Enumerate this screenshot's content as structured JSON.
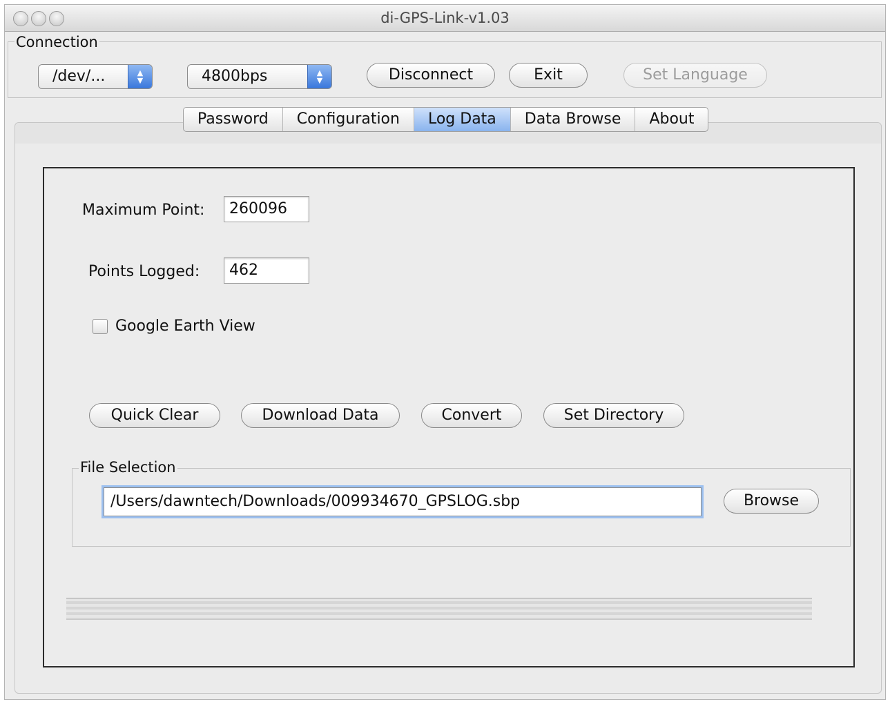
{
  "window": {
    "title": "di-GPS-Link-v1.03"
  },
  "connection": {
    "group_label": "Connection",
    "port_value": "/dev/...",
    "baud_value": "4800bps",
    "disconnect_label": "Disconnect",
    "exit_label": "Exit",
    "set_language_label": "Set Language"
  },
  "tabs": [
    {
      "label": "Password",
      "active": false
    },
    {
      "label": "Configuration",
      "active": false
    },
    {
      "label": "Log Data",
      "active": true
    },
    {
      "label": "Data Browse",
      "active": false
    },
    {
      "label": "About",
      "active": false
    }
  ],
  "log_data": {
    "max_point_label": "Maximum Point:",
    "max_point_value": "260096",
    "points_logged_label": "Points Logged:",
    "points_logged_value": "462",
    "google_earth_label": "Google Earth View",
    "google_earth_checked": false,
    "buttons": {
      "quick_clear": "Quick Clear",
      "download_data": "Download Data",
      "convert": "Convert",
      "set_directory": "Set Directory"
    },
    "file_selection": {
      "group_label": "File Selection",
      "path_value": "/Users/dawntech/Downloads/009934670_GPSLOG.sbp",
      "browse_label": "Browse"
    },
    "progress_fraction": 0
  },
  "colors": {
    "accent": "#3a78dc",
    "tab_active": "#8ab4ee",
    "focus_ring": "#9cc0f0"
  }
}
